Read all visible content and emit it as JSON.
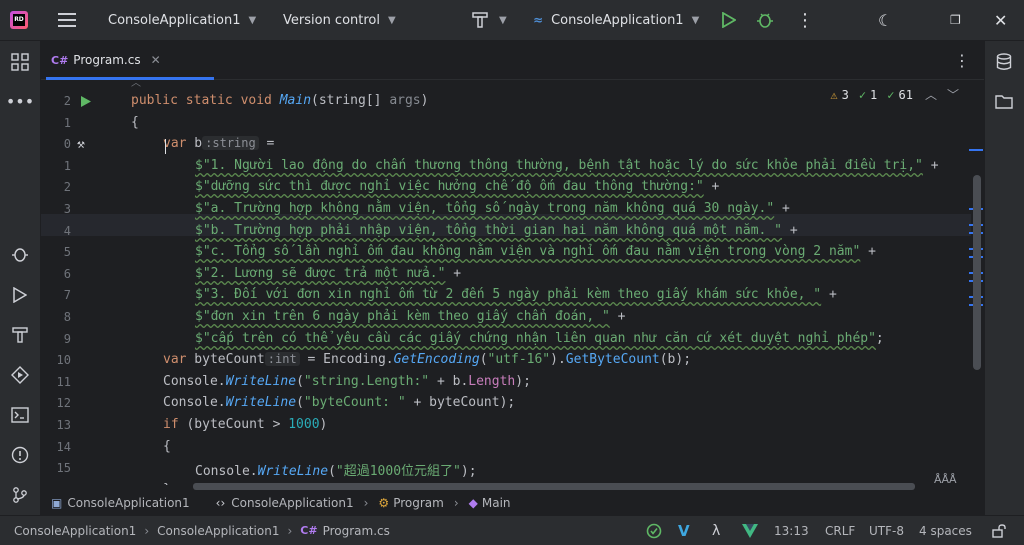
{
  "titlebar": {
    "app_badge": "RD",
    "project": "ConsoleApplication1",
    "vcs": "Version control",
    "run_config": "ConsoleApplication1"
  },
  "tab": {
    "lang": "C#",
    "name": "Program.cs"
  },
  "inspections": {
    "warnings": "3",
    "weak": "1",
    "typos": "61"
  },
  "code_lines": [
    {
      "num": "2",
      "text": ""
    },
    {
      "num": "1",
      "text": ""
    },
    {
      "num": "0",
      "text": ""
    },
    {
      "num": "1",
      "text": ""
    },
    {
      "num": "2",
      "text": ""
    },
    {
      "num": "3",
      "text": ""
    },
    {
      "num": "4",
      "text": ""
    },
    {
      "num": "5",
      "text": ""
    },
    {
      "num": "6",
      "text": ""
    },
    {
      "num": "7",
      "text": ""
    },
    {
      "num": "8",
      "text": ""
    },
    {
      "num": "9",
      "text": ""
    },
    {
      "num": "10",
      "text": ""
    },
    {
      "num": "11",
      "text": ""
    },
    {
      "num": "12",
      "text": ""
    },
    {
      "num": "13",
      "text": ""
    },
    {
      "num": "14",
      "text": ""
    },
    {
      "num": "15",
      "text": ""
    }
  ],
  "code": {
    "l0": "public static void ",
    "l0fn": "Main",
    "l0b": "(string[] ",
    "l0p": "args",
    "l0c": ")",
    "l1": "{",
    "l2a": "var",
    "l2b": " b",
    "l2hint": ":string",
    "l2c": " =",
    "s1": "$\"1. Người lao động do chấn thương thông thường, bệnh tật hoặc lý do sức khỏe phải điều trị,\"",
    "s2": "$\"dưỡng sức thì được nghỉ việc hưởng chế độ ốm đau thông thường:\"",
    "s3": "$\"a. Trường hợp không nằm viện, tổng số ngày trong năm không quá 30 ngày.\"",
    "s4": "$\"b. Trường hợp phải nhập viện, tổng thời gian hai năm không quá một năm. \"",
    "s5": "$\"c. Tổng số lần nghỉ ốm đau không nằm viện và nghỉ ốm đau nằm viện trong vòng 2 năm\"",
    "s6": "$\"2. Lương sẽ được trả một nửa.\"",
    "s7": "$\"3. Đối với đơn xin nghỉ ốm từ 2 đến 5 ngày phải kèm theo giấy khám sức khỏe, \"",
    "s8": "$\"đơn xin trên 6 ngày phải kèm theo giấy chẩn đoán, \"",
    "s9": "$\"cấp trên có thể yêu cầu các giấy chứng nhận liên quan như căn cứ xét duyệt nghỉ phép\"",
    "plus": " +",
    "semi": ";",
    "l10a": "var",
    "l10b": " byteCount",
    "l10hint": ":int",
    "l10c": " = Encoding.",
    "l10fn": "GetEncoding",
    "l10d": "(",
    "l10s": "\"utf-16\"",
    "l10e": ").",
    "l10fn2": "GetByteCount",
    "l10f": "(b);",
    "l11a": "Console.",
    "l11fn": "WriteLine",
    "l11b": "(",
    "l11s": "\"string.Length:\"",
    "l11c": " + b.",
    "l11p": "Length",
    "l11d": ");",
    "l12a": "Console.",
    "l12fn": "WriteLine",
    "l12b": "(",
    "l12s": "\"byteCount: \"",
    "l12c": " + byteCount);",
    "l13a": "if",
    "l13b": " (byteCount > ",
    "l13n": "1000",
    "l13c": ")",
    "l14": "{",
    "l15a": "Console.",
    "l15fn": "WriteLine",
    "l15b": "(",
    "l15s": "\"超過1000位元組了\"",
    "l15c": ");",
    "l16": "}"
  },
  "breadcrumb": [
    "ConsoleApplication1",
    "ConsoleApplication1",
    "Program",
    "Main"
  ],
  "status": {
    "path": [
      "ConsoleApplication1",
      "ConsoleApplication1",
      "Program.cs"
    ],
    "path_lang": "C#",
    "position": "13:13",
    "line_sep": "CRLF",
    "encoding": "UTF-8",
    "indent": "4 spaces"
  },
  "colors": {
    "accent": "#3574f0",
    "run": "#5fb865",
    "string": "#6aab73",
    "keyword": "#cf8e6d"
  }
}
